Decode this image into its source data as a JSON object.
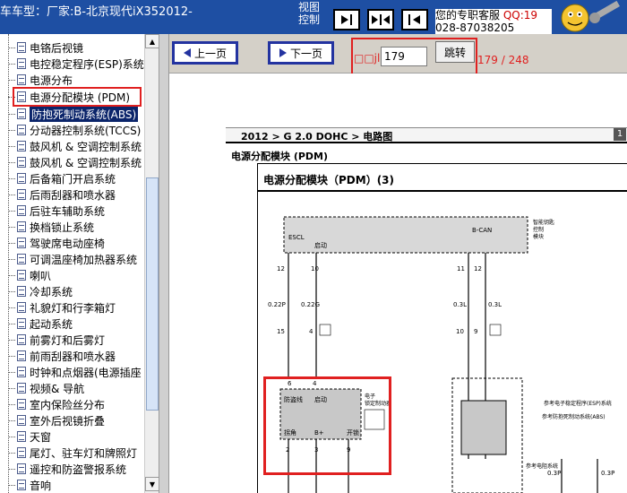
{
  "header": {
    "vehicle_info": "车车型：厂家:B-北京现代iX352012-",
    "view_control": [
      "视图",
      "控制"
    ],
    "nav_icons": [
      "first-page-icon",
      "fit-page-icon",
      "prev-icon"
    ],
    "service_text": "您的专职客服",
    "service_qq": "QQ:19",
    "service_phone": "028-87038205"
  },
  "sidebar": {
    "items": [
      {
        "label": "电铬后视镜"
      },
      {
        "label": "电控稳定程序(ESP)系统"
      },
      {
        "label": "电源分布"
      },
      {
        "label": "电源分配模块 (PDM)",
        "highlighted": true
      },
      {
        "label": "防抱死制动系统(ABS)",
        "selected": true
      },
      {
        "label": "分动器控制系统(TCCS)"
      },
      {
        "label": "鼓风机 & 空调控制系统"
      },
      {
        "label": "鼓风机 & 空调控制系统"
      },
      {
        "label": "后备箱门开启系统"
      },
      {
        "label": "后雨刮器和喷水器"
      },
      {
        "label": "后驻车辅助系统"
      },
      {
        "label": "换档锁止系统"
      },
      {
        "label": "驾驶席电动座椅"
      },
      {
        "label": "可调温座椅加热器系统"
      },
      {
        "label": "喇叭"
      },
      {
        "label": "冷却系统"
      },
      {
        "label": "礼貌灯和行李箱灯"
      },
      {
        "label": "起动系统"
      },
      {
        "label": "前雾灯和后雾灯"
      },
      {
        "label": "前雨刮器和喷水器"
      },
      {
        "label": "时钟和点烟器(电源插座"
      },
      {
        "label": "视频& 导航"
      },
      {
        "label": "室内保险丝分布"
      },
      {
        "label": "室外后视镜折叠"
      },
      {
        "label": "天窗"
      },
      {
        "label": "尾灯、驻车灯和牌照灯"
      },
      {
        "label": "遥控和防盗警报系统"
      },
      {
        "label": "音响"
      }
    ]
  },
  "toolbar": {
    "prev_label": "上一页",
    "next_label": "下一页",
    "goto_label": "□□jl",
    "page_input_value": "179",
    "goto_button": "跳转",
    "page_counter": "179 / 248"
  },
  "document": {
    "breadcrumb": "2012 > G 2.0 DOHC > 电路图",
    "page_badge": "1",
    "section_title": "电源分配模块 (PDM)",
    "diagram_title": "电源分配模块（PDM）(3)",
    "connector_labels": {
      "escl": "ESCL",
      "qidong": "启动",
      "bcan": "B-CAN",
      "smart_key": [
        "智能钥匙",
        "控制",
        "模块"
      ],
      "pdm_box": [
        "防盗线",
        "启动",
        "电子",
        "锁定制动器"
      ],
      "pdm_pins": [
        "拐角",
        "B+",
        "开锁"
      ],
      "pins_top": [
        "12",
        "10",
        "11",
        "12"
      ],
      "wires": [
        "0.22P",
        "0.22G",
        "0.3L",
        "0.3L"
      ],
      "pins_mid": [
        "15",
        "4",
        "10",
        "9"
      ],
      "pins_box_top": [
        "6",
        "4"
      ],
      "pins_box_bottom": [
        "2",
        "3",
        "9"
      ],
      "right_refs": [
        "参考电阻系统",
        "参考电子稳定程序(ESP)系统",
        "参考防抱死制动系统(ABS)"
      ],
      "right_wires": [
        "0.3P",
        "0.3P"
      ]
    }
  }
}
